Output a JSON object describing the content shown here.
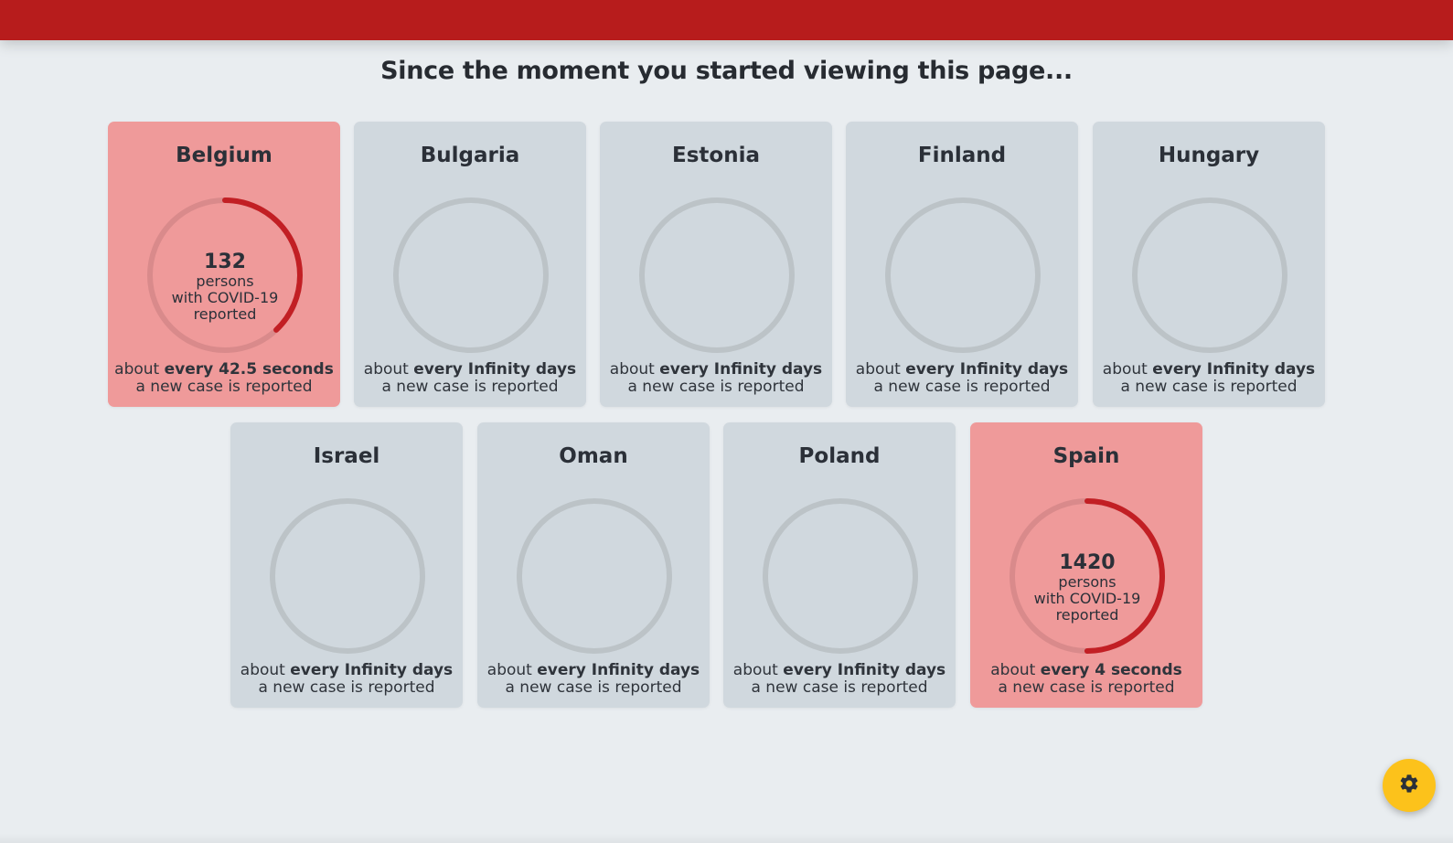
{
  "header": {
    "title": "Since the moment you started viewing this page..."
  },
  "colors": {
    "topbar": "#b71c1c",
    "card_inactive": "#d0d8de",
    "card_active": "#ef9a9a",
    "ring_track": "#bcc3c7",
    "ring_progress": "#c21f24",
    "settings_button": "#fcc21b"
  },
  "cards": [
    {
      "country": "Belgium",
      "active": true,
      "progress": 0.38,
      "count": "132",
      "line1": "persons",
      "line2": "with COVID-19",
      "line3": "reported",
      "rate_prefix": "about ",
      "rate_bold": "every 42.5 seconds",
      "rate_suffix": "a new case is reported"
    },
    {
      "country": "Bulgaria",
      "active": false,
      "progress": 0,
      "count": "",
      "line1": "",
      "line2": "",
      "line3": "",
      "rate_prefix": "about ",
      "rate_bold": "every Infinity days",
      "rate_suffix": "a new case is reported"
    },
    {
      "country": "Estonia",
      "active": false,
      "progress": 0,
      "count": "",
      "line1": "",
      "line2": "",
      "line3": "",
      "rate_prefix": "about ",
      "rate_bold": "every Infinity days",
      "rate_suffix": "a new case is reported"
    },
    {
      "country": "Finland",
      "active": false,
      "progress": 0,
      "count": "",
      "line1": "",
      "line2": "",
      "line3": "",
      "rate_prefix": "about ",
      "rate_bold": "every Infinity days",
      "rate_suffix": "a new case is reported"
    },
    {
      "country": "Hungary",
      "active": false,
      "progress": 0,
      "count": "",
      "line1": "",
      "line2": "",
      "line3": "",
      "rate_prefix": "about ",
      "rate_bold": "every Infinity days",
      "rate_suffix": "a new case is reported"
    },
    {
      "country": "Israel",
      "active": false,
      "progress": 0,
      "count": "",
      "line1": "",
      "line2": "",
      "line3": "",
      "rate_prefix": "about ",
      "rate_bold": "every Infinity days",
      "rate_suffix": "a new case is reported"
    },
    {
      "country": "Oman",
      "active": false,
      "progress": 0,
      "count": "",
      "line1": "",
      "line2": "",
      "line3": "",
      "rate_prefix": "about ",
      "rate_bold": "every Infinity days",
      "rate_suffix": "a new case is reported"
    },
    {
      "country": "Poland",
      "active": false,
      "progress": 0,
      "count": "",
      "line1": "",
      "line2": "",
      "line3": "",
      "rate_prefix": "about ",
      "rate_bold": "every Infinity days",
      "rate_suffix": "a new case is reported"
    },
    {
      "country": "Spain",
      "active": true,
      "progress": 0.5,
      "count": "1420",
      "line1": "persons",
      "line2": "with COVID-19",
      "line3": "reported",
      "rate_prefix": "about ",
      "rate_bold": "every 4 seconds",
      "rate_suffix": "a new case is reported"
    }
  ],
  "settings": {
    "icon": "gear-icon"
  }
}
